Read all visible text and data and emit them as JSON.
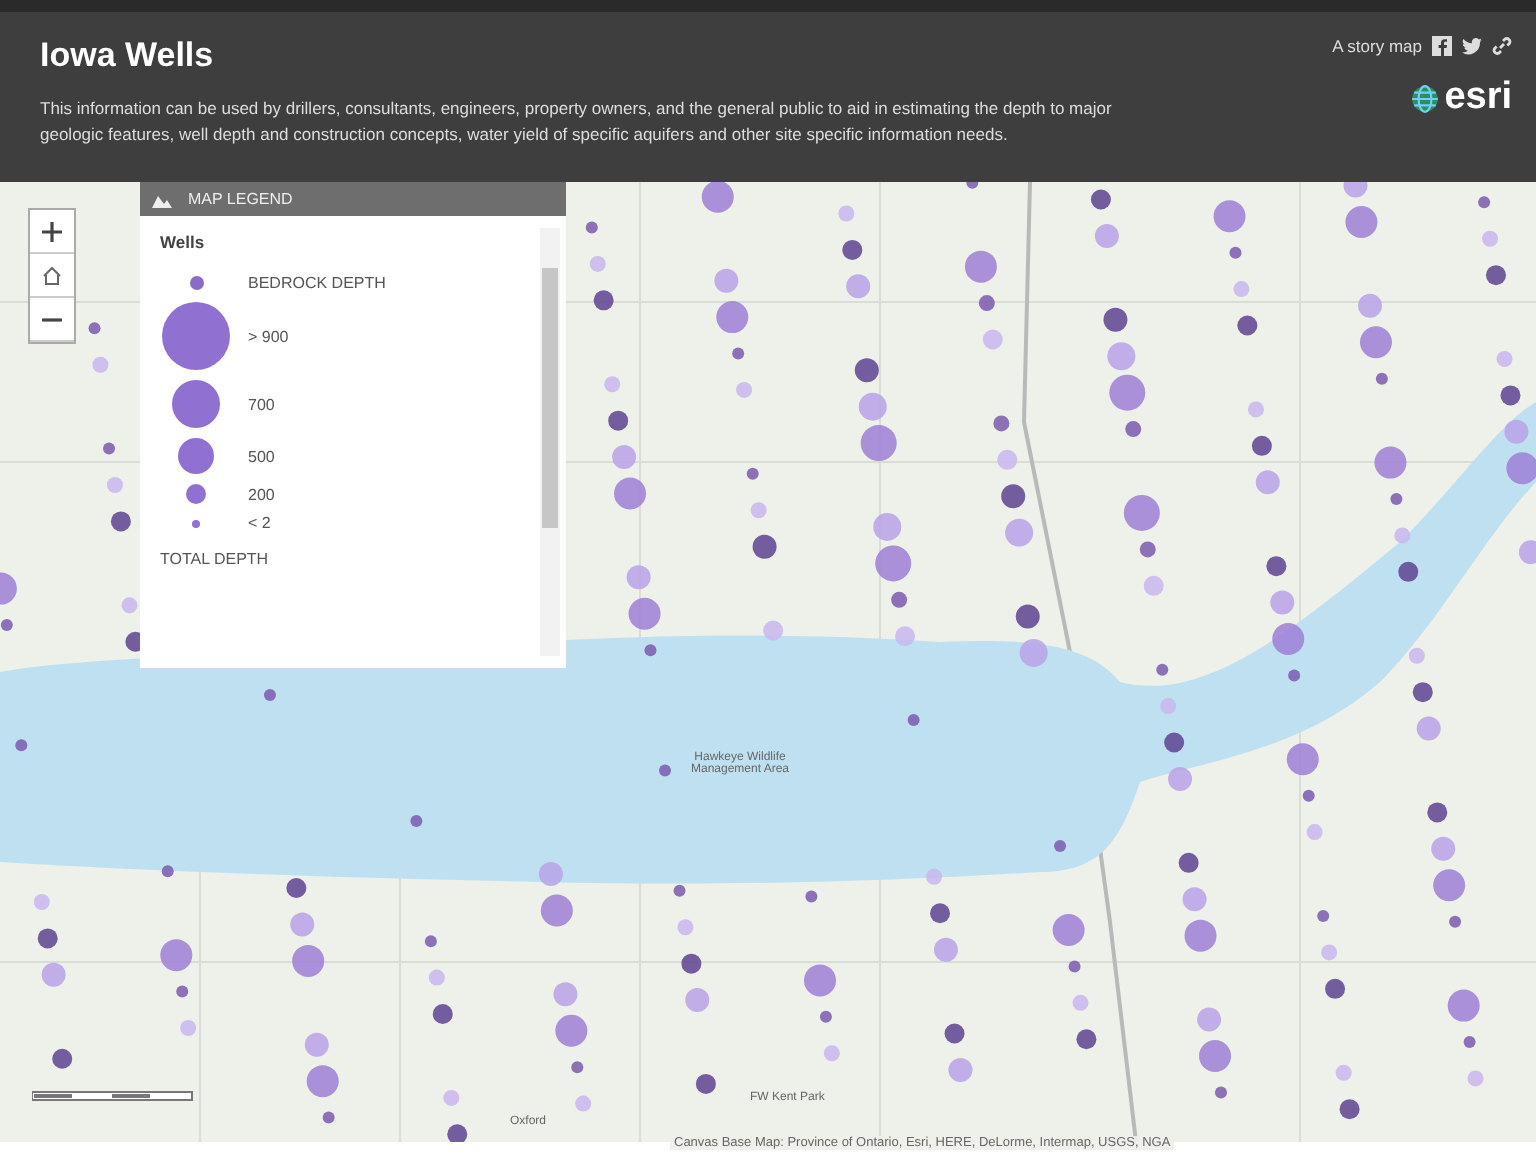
{
  "header": {
    "title": "Iowa Wells",
    "description": "This information can be used by drillers, consultants, engineers, property owners, and the general public to aid in estimating the depth to major geologic features, well depth and construction concepts, water yield of specific aquifers and other site specific information needs.",
    "story_label": "A story map",
    "logo_text": "esri"
  },
  "legend": {
    "title": "MAP LEGEND",
    "layer": "Wells",
    "items": [
      {
        "kind": "point",
        "label": "BEDROCK DEPTH"
      },
      {
        "kind": "size",
        "label": "> 900"
      },
      {
        "kind": "size",
        "label": "700"
      },
      {
        "kind": "size",
        "label": "500"
      },
      {
        "kind": "size",
        "label": "200"
      },
      {
        "kind": "size",
        "label": "< 2"
      },
      {
        "kind": "heading",
        "label": "TOTAL DEPTH"
      }
    ]
  },
  "map": {
    "labels": [
      "Hawkeye Wildlife Management Area",
      "FW Kent Park",
      "Oxford"
    ],
    "attribution": "Canvas Base Map: Province of Ontario, Esri, HERE, DeLorme, Intermap, USGS, NGA"
  }
}
